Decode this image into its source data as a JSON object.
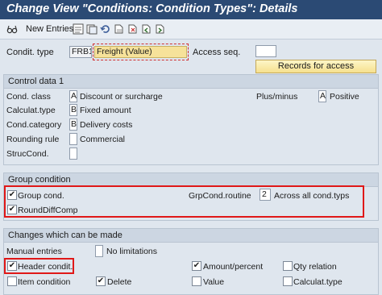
{
  "title": "Change View \"Conditions: Condition Types\": Details",
  "toolbar": {
    "new_entries": "New Entries",
    "icons": [
      "glasses-icon",
      "save-icon",
      "back-icon",
      "undo-icon",
      "copy-icon",
      "delete-icon",
      "previous-entry-icon",
      "next-entry-icon"
    ]
  },
  "header": {
    "condit_type_label": "Condit. type",
    "condit_type_code": "FRB1",
    "condit_type_name": "Freight (Value)",
    "access_seq_label": "Access seq.",
    "access_seq_value": "",
    "records_button": "Records for access"
  },
  "control": {
    "heading": "Control data 1",
    "rows": [
      {
        "label": "Cond. class",
        "code": "A",
        "text": "Discount or surcharge"
      },
      {
        "label": "Calculat.type",
        "code": "B",
        "text": "Fixed amount"
      },
      {
        "label": "Cond.category",
        "code": "B",
        "text": "Delivery costs"
      },
      {
        "label": "Rounding rule",
        "code": "",
        "text": "Commercial"
      },
      {
        "label": "StrucCond.",
        "code": "",
        "text": ""
      }
    ],
    "plus_minus_label": "Plus/minus",
    "plus_minus_code": "A",
    "plus_minus_text": "Positive"
  },
  "group": {
    "heading": "Group condition",
    "group_cond_label": "Group cond.",
    "group_cond_checked": true,
    "round_diff_label": "RoundDiffComp",
    "round_diff_checked": true,
    "routine_label": "GrpCond.routine",
    "routine_value": "2",
    "routine_text": "Across all cond.typs"
  },
  "changes": {
    "heading": "Changes which can be made",
    "manual_label": "Manual entries",
    "manual_code": "",
    "manual_text": "No limitations",
    "header_condit": {
      "label": "Header condit.",
      "checked": true
    },
    "item_condition": {
      "label": "Item condition",
      "checked": false
    },
    "delete": {
      "label": "Delete",
      "checked": true
    },
    "amount_percent": {
      "label": "Amount/percent",
      "checked": true
    },
    "value": {
      "label": "Value",
      "checked": false
    },
    "qty_relation": {
      "label": "Qty relation",
      "checked": false
    },
    "calculat_type": {
      "label": "Calculat.type",
      "checked": false
    }
  },
  "colors": {
    "title_bar": "#2b4a74",
    "highlight_field": "#f6e29a",
    "annotation_red": "#e01818"
  }
}
